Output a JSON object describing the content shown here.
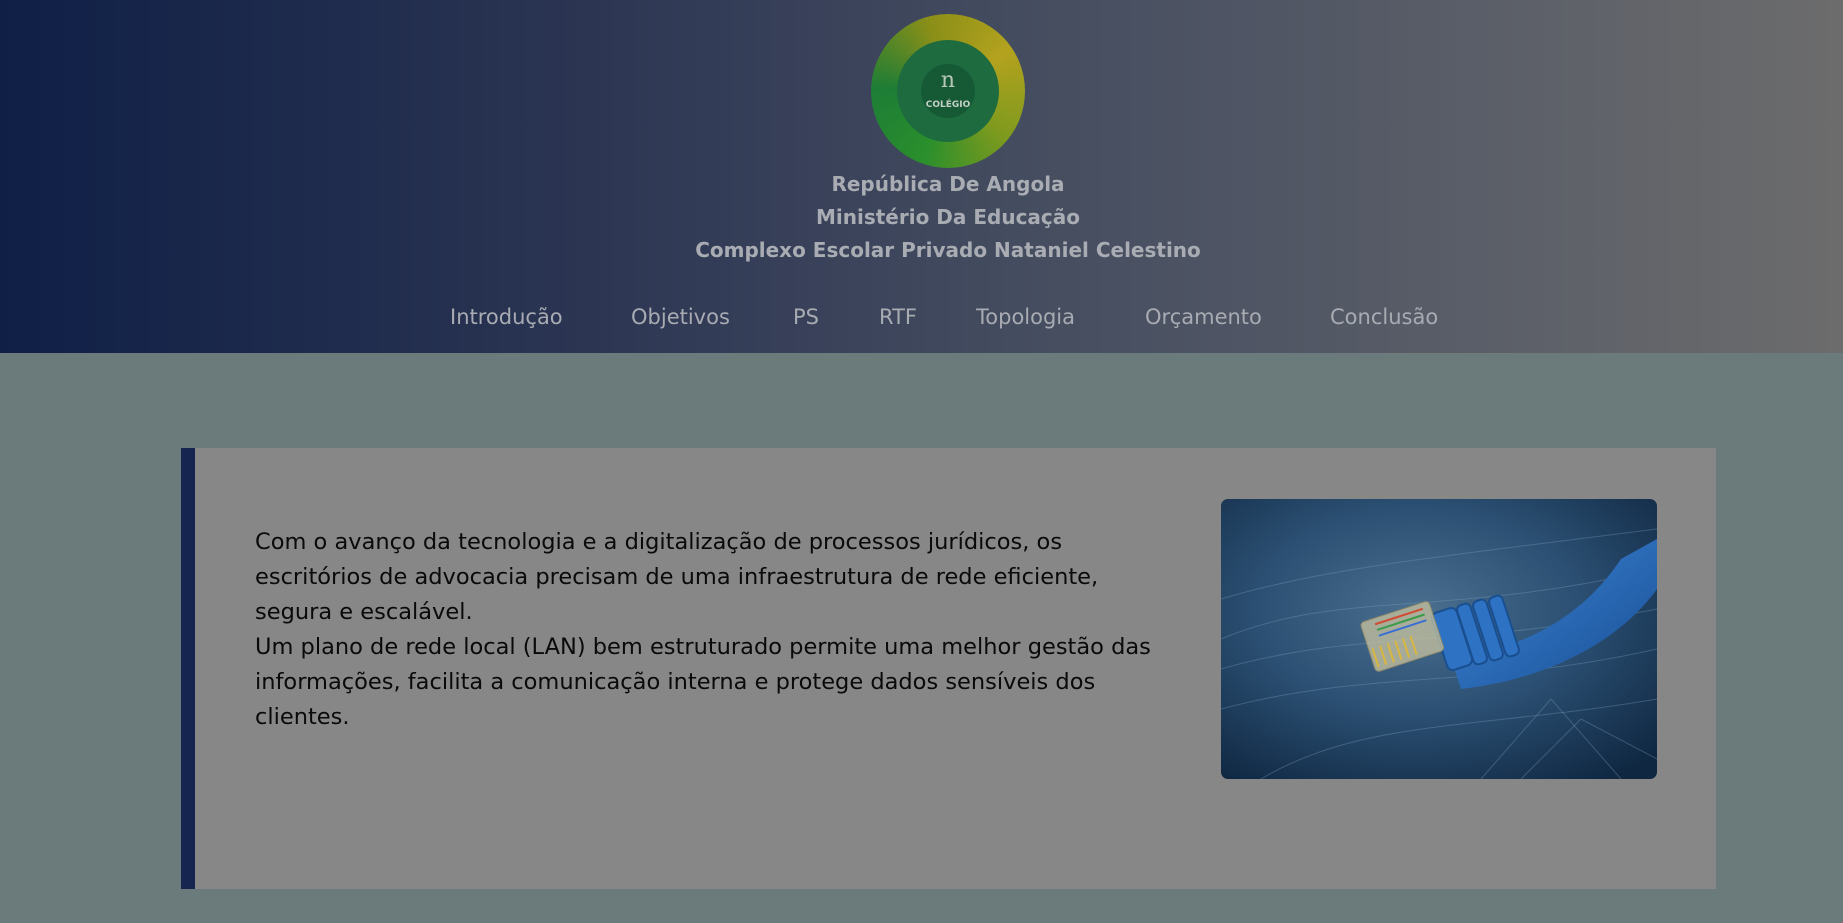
{
  "header": {
    "logo": {
      "icon": "school-logo-icon",
      "letter": "n",
      "text": "COLÉGIO"
    },
    "title_lines": [
      "República De Angola",
      "Ministério Da Educação",
      "Complexo Escolar Privado Nataniel Celestino"
    ]
  },
  "nav": {
    "items": [
      {
        "label": "Introdução"
      },
      {
        "label": "Objetivos"
      },
      {
        "label": "PS"
      },
      {
        "label": "RTF"
      },
      {
        "label": "Topologia"
      },
      {
        "label": "Orçamento"
      },
      {
        "label": "Conclusão"
      }
    ]
  },
  "main": {
    "paragraphs": [
      "Com o avanço da tecnologia e a digitalização de processos jurídicos, os escritórios de advocacia precisam de uma infraestrutura de rede eficiente, segura e escalável.",
      "Um plano de rede local (LAN) bem estruturado permite uma melhor gestão das informações, facilita a comunicação interna e protege dados sensíveis dos clientes."
    ],
    "image": {
      "icon": "network-cable-image"
    }
  },
  "colors": {
    "header_gradient_start": "#0f1f46",
    "header_gradient_end": "#6c6c6c",
    "page_background": "#6b7a7a",
    "card_background": "#878787",
    "card_accent": "#152550",
    "cable_blue": "#1f5fb0"
  }
}
